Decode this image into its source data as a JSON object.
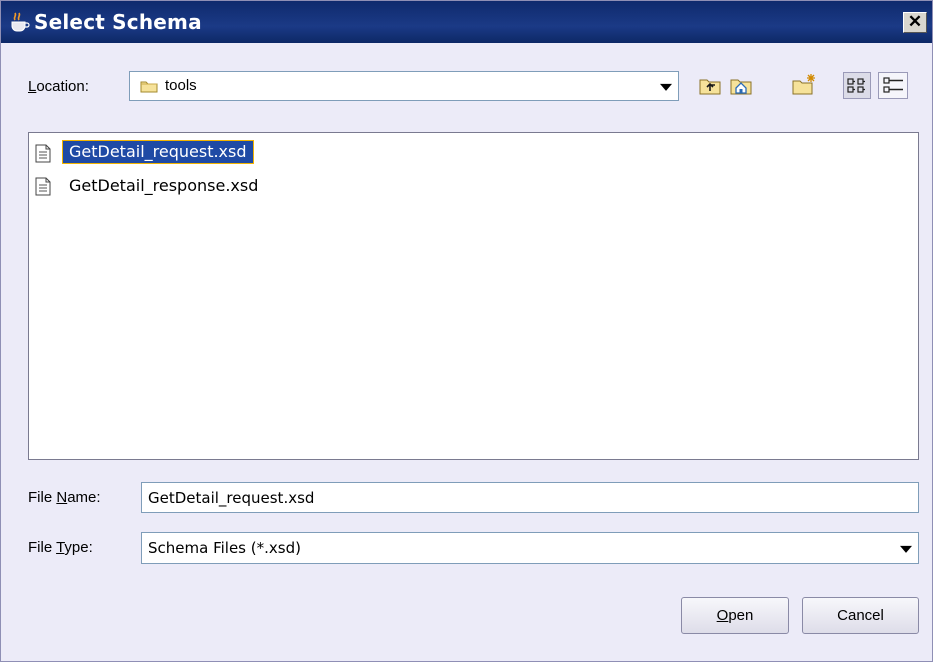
{
  "window": {
    "title": "Select Schema",
    "close_symbol": "✕"
  },
  "location": {
    "label_prefix": "",
    "label_mnemonic": "L",
    "label_rest": "ocation:",
    "value": "tools",
    "icon": "folder-icon"
  },
  "toolbar": {
    "buttons": [
      {
        "name": "up-one-level-button",
        "icon": "folder-up-icon"
      },
      {
        "name": "home-button",
        "icon": "home-icon"
      },
      {
        "name": "new-folder-button",
        "icon": "new-folder-icon"
      },
      {
        "name": "list-view-button",
        "icon": "list-view-icon",
        "state": "pressed"
      },
      {
        "name": "details-view-button",
        "icon": "details-view-icon"
      }
    ]
  },
  "files": [
    {
      "name": "GetDetail_request.xsd",
      "selected": true
    },
    {
      "name": "GetDetail_response.xsd",
      "selected": false
    }
  ],
  "file_name": {
    "label_prefix": "File ",
    "label_mnemonic": "N",
    "label_rest": "ame:",
    "value": "GetDetail_request.xsd"
  },
  "file_type": {
    "label_prefix": "File ",
    "label_mnemonic": "T",
    "label_rest": "ype:",
    "value": "Schema Files (*.xsd)"
  },
  "buttons": {
    "open_mnemonic": "O",
    "open_rest": "pen",
    "cancel": "Cancel"
  },
  "colors": {
    "titlebar": "#1b3a86",
    "selection": "#1f4aa5",
    "dialog_bg": "#ecebf8"
  }
}
